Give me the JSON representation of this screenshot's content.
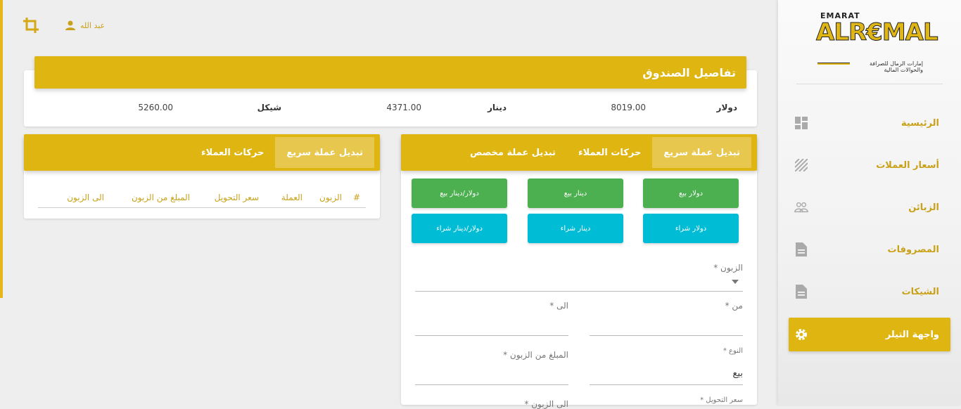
{
  "topbar": {
    "user_name": "عبد الله"
  },
  "treasury": {
    "title": "تفاصيل الصندوق",
    "balances": [
      {
        "currency": "دولار",
        "amount": "8019.00"
      },
      {
        "currency": "دينار",
        "amount": "4371.00"
      },
      {
        "currency": "شيكل",
        "amount": "5260.00"
      }
    ]
  },
  "exchange_tabs": [
    "تبديل عملة سريع",
    "حركات العملاء",
    "تبديل عملة مخصص"
  ],
  "movements_tabs": [
    "تبديل عملة سريع",
    "حركات العملاء"
  ],
  "quick_buttons": {
    "sell": [
      "دولار بيع",
      "دينار بيع",
      "دولار/دينار بيع"
    ],
    "buy": [
      "دولار شراء",
      "دينار شراء",
      "دولار/دينار شراء"
    ]
  },
  "form": {
    "customer_label": "الزبون *",
    "from_label": "من *",
    "to_label": "الى *",
    "type_label": "النوع *",
    "type_value": "بيع",
    "amount_from_label": "المبلغ من الزبون *",
    "rate_label": "سعر التحويل *",
    "to_customer_label": "الى الزبون *"
  },
  "table": {
    "headers": [
      "#",
      "الزبون",
      "العملة",
      "سعر التحويل",
      "المبلغ من الزبون",
      "الى الزبون"
    ]
  },
  "sidebar": {
    "logo_top": "EMARAT",
    "logo_main": "ALR€MAL",
    "logo_tag": "إمارات الرمال للصرافة والحوالات المالية",
    "items": [
      {
        "label": "الرئيسية",
        "icon": "dashboard-icon"
      },
      {
        "label": "أسعار العملات",
        "icon": "pattern-icon"
      },
      {
        "label": "الزبائن",
        "icon": "people-icon"
      },
      {
        "label": "المصروفات",
        "icon": "document-icon"
      },
      {
        "label": "الشيكات",
        "icon": "document-icon"
      },
      {
        "label": "واجهة التيلر",
        "icon": "gear-icon"
      }
    ]
  },
  "colors": {
    "gold": "#dfb512",
    "green": "#4caf50",
    "cyan": "#00bcd4"
  }
}
